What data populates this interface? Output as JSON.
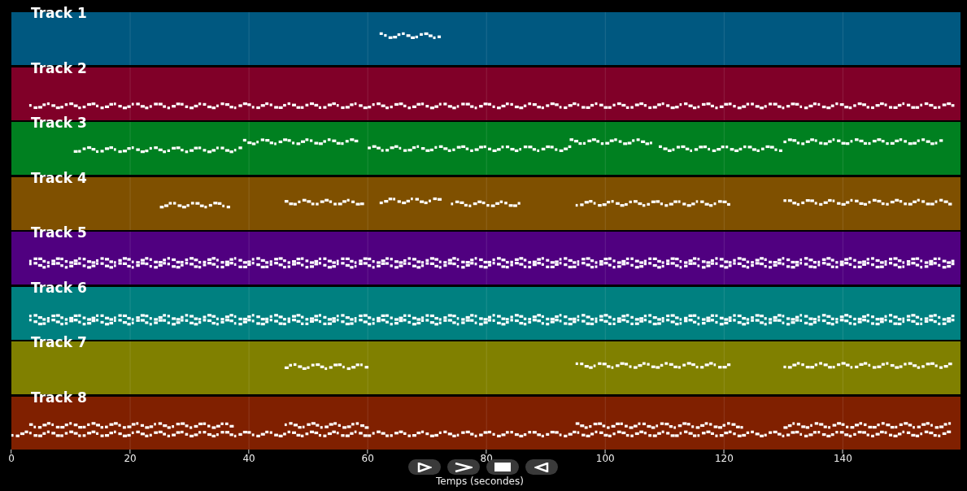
{
  "tracks": [
    {
      "label": "Track 1",
      "color": "#005880"
    },
    {
      "label": "Track 2",
      "color": "#800028"
    },
    {
      "label": "Track 3",
      "color": "#008020"
    },
    {
      "label": "Track 4",
      "color": "#7f5000"
    },
    {
      "label": "Track 5",
      "color": "#500080"
    },
    {
      "label": "Track 6",
      "color": "#008080"
    },
    {
      "label": "Track 7",
      "color": "#808000"
    },
    {
      "label": "Track 8",
      "color": "#802000"
    }
  ],
  "x_axis": {
    "ticks": [
      "0",
      "20",
      "40",
      "60",
      "80",
      "100",
      "120",
      "140"
    ],
    "label": "Temps (secondes)"
  },
  "controls": [
    {
      "kind": "play"
    },
    {
      "kind": "forward"
    },
    {
      "kind": "stop"
    },
    {
      "kind": "reverse"
    }
  ]
}
